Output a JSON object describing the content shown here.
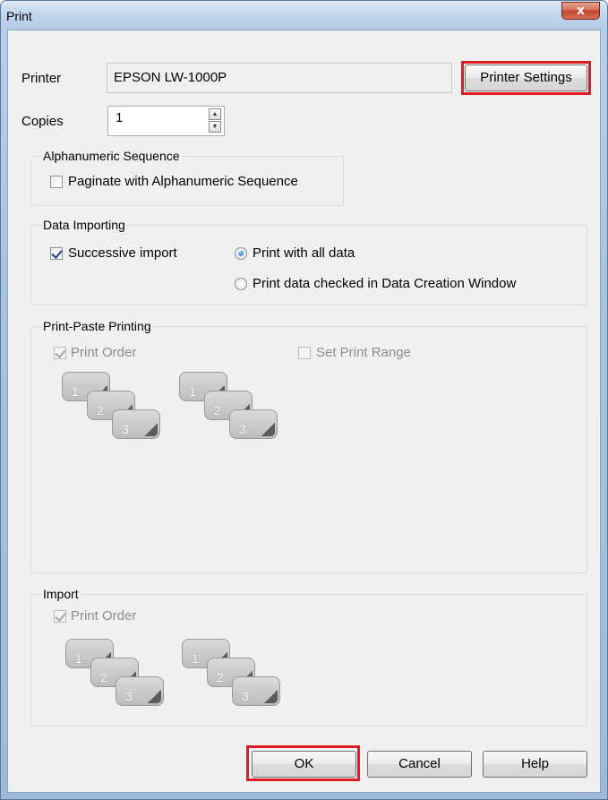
{
  "window": {
    "title": "Print",
    "close_glyph": "x"
  },
  "printer": {
    "label": "Printer",
    "value": "EPSON LW-1000P",
    "settings_button": "Printer Settings"
  },
  "copies": {
    "label": "Copies",
    "value": "1"
  },
  "alphanumeric": {
    "legend": "Alphanumeric Sequence",
    "paginate_label": "Paginate with Alphanumeric Sequence",
    "paginate_checked": false
  },
  "data_importing": {
    "legend": "Data Importing",
    "successive_label": "Successive import",
    "successive_checked": true,
    "options": [
      "Print with all data",
      "Print data checked in Data Creation Window"
    ],
    "selected_option": "Print with all data"
  },
  "print_paste": {
    "legend": "Print-Paste Printing",
    "print_order_label": "Print Order",
    "print_order_checked": true,
    "set_range_label": "Set Print Range",
    "set_range_checked": false,
    "card_numbers": [
      "1",
      "2",
      "3"
    ]
  },
  "import": {
    "legend": "Import",
    "print_order_label": "Print Order",
    "print_order_checked": true,
    "card_numbers": [
      "1",
      "2",
      "3"
    ]
  },
  "buttons": {
    "ok": "OK",
    "cancel": "Cancel",
    "help": "Help"
  },
  "colors": {
    "highlight": "#e01b22",
    "title_bar": "#c3d6ec",
    "dialog_bg": "#f0f0f0"
  },
  "icons": [
    "close-icon",
    "spin-up-icon",
    "spin-down-icon",
    "card-stack-icon"
  ]
}
